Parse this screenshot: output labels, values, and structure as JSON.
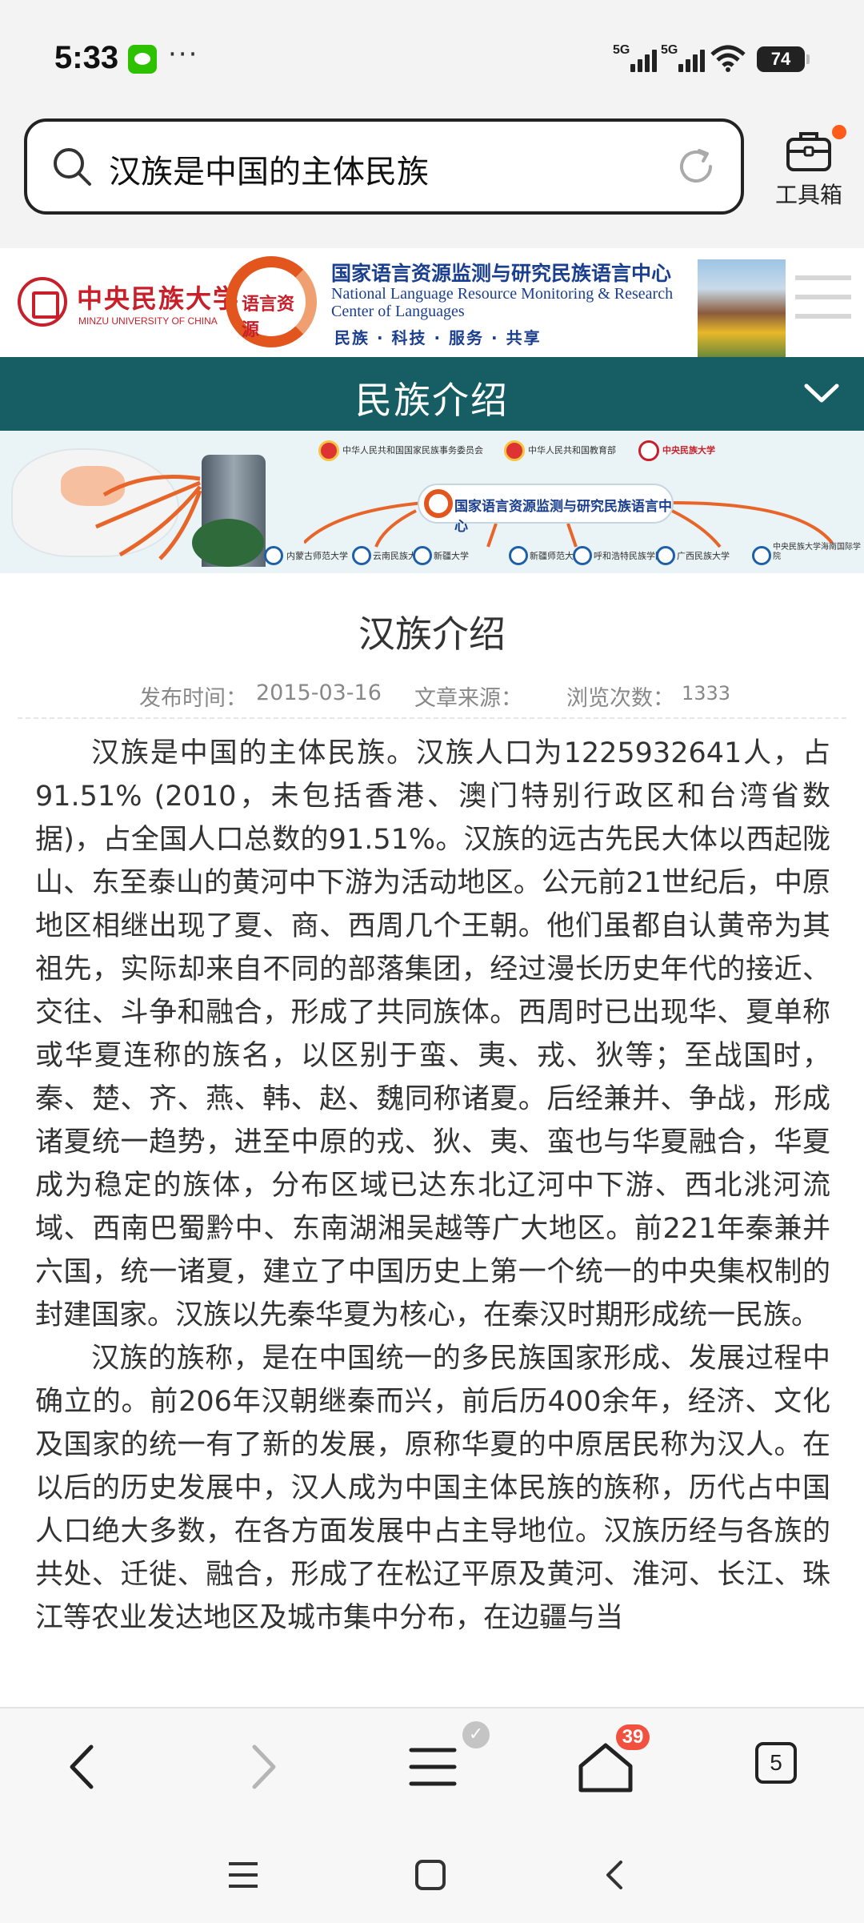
{
  "status_bar": {
    "time": "5:33",
    "signal_1": "5G",
    "signal_2": "5G",
    "battery": "74"
  },
  "search": {
    "query": "汉族是中国的主体民族"
  },
  "toolbox": {
    "label": "工具箱"
  },
  "site_header": {
    "university_name": "中央民族大学",
    "university_name_en": "MINZU UNIVERSITY OF CHINA",
    "center_logo_text": "语言资源",
    "center_title": "国家语言资源监测与研究民族语言中心",
    "center_title_en_1": "National Language Resource Monitoring & Research",
    "center_title_en_2": "Center of Languages",
    "motto": "民族 · 科技 · 服务 · 共享"
  },
  "section": {
    "title": "民族介绍"
  },
  "banner": {
    "top_orgs": [
      "中华人民共和国国家民族事务委员会",
      "中华人民共和国教育部",
      "中央民族大学"
    ],
    "center_label": "国家语言资源监测与研究民族语言中心",
    "bases": [
      "内蒙古师范大学",
      "云南民族大学",
      "新疆大学",
      "新疆师范大学",
      "呼和浩特民族学院",
      "广西民族大学",
      "中央民族大学海南国际学院"
    ]
  },
  "article": {
    "title": "汉族介绍",
    "publish_label": "发布时间：",
    "publish_date": "2015-03-16",
    "source_label": "文章来源：",
    "views_label": "浏览次数：",
    "views": "1333",
    "paragraphs": [
      "汉族是中国的主体民族。汉族人口为1225932641人，占91.51% (2010，未包括香港、澳门特别行政区和台湾省数据)，占全国人口总数的91.51%。汉族的远古先民大体以西起陇山、东至泰山的黄河中下游为活动地区。公元前21世纪后，中原地区相继出现了夏、商、西周几个王朝。他们虽都自认黄帝为其祖先，实际却来自不同的部落集团，经过漫长历史年代的接近、交往、斗争和融合，形成了共同族体。西周时已出现华、夏单称或华夏连称的族名，以区别于蛮、夷、戎、狄等；至战国时，秦、楚、齐、燕、韩、赵、魏同称诸夏。后经兼并、争战，形成诸夏统一趋势，进至中原的戎、狄、夷、蛮也与华夏融合，华夏成为稳定的族体，分布区域已达东北辽河中下游、西北洮河流域、西南巴蜀黔中、东南湖湘吴越等广大地区。前221年秦兼并六国，统一诸夏，建立了中国历史上第一个统一的中央集权制的封建国家。汉族以先秦华夏为核心，在秦汉时期形成统一民族。",
      "汉族的族称，是在中国统一的多民族国家形成、发展过程中确立的。前206年汉朝继秦而兴，前后历400余年，经济、文化及国家的统一有了新的发展，原称华夏的中原居民称为汉人。在以后的历史发展中，汉人成为中国主体民族的族称，历代占中国人口绝大多数，在各方面发展中占主导地位。汉族历经与各族的共处、迁徙、融合，形成了在松辽平原及黄河、淮河、长江、珠江等农业发达地区及城市集中分布，在边疆与当"
    ]
  },
  "bottom_bar": {
    "menu_badge": "✓",
    "home_badge": "39",
    "tabs_count": "5"
  }
}
